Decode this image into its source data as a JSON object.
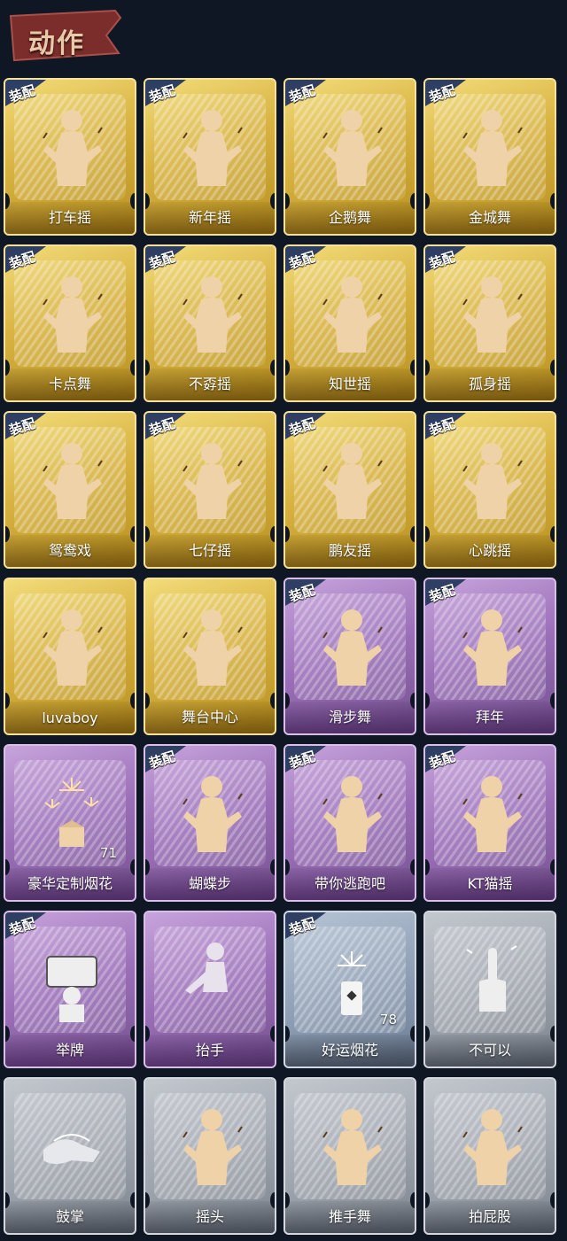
{
  "header": {
    "title": "动作"
  },
  "equip_badge": "装配",
  "colors": {
    "gold": "#d8b342",
    "purple": "#9b6fb8",
    "blue": "#8d9db3",
    "gray": "#9ea4ad",
    "background": "#0f1624"
  },
  "cards": [
    {
      "label": "打车摇",
      "tier": "gold",
      "equipped": true,
      "icon": "dance-figure-icon"
    },
    {
      "label": "新年摇",
      "tier": "gold",
      "equipped": true,
      "icon": "dance-figure-icon"
    },
    {
      "label": "企鹅舞",
      "tier": "gold",
      "equipped": true,
      "icon": "dance-figure-icon"
    },
    {
      "label": "金城舞",
      "tier": "gold",
      "equipped": true,
      "icon": "dance-figure-icon"
    },
    {
      "label": "卡点舞",
      "tier": "gold",
      "equipped": true,
      "icon": "dance-figure-icon"
    },
    {
      "label": "不孬摇",
      "tier": "gold",
      "equipped": true,
      "icon": "dance-figure-icon"
    },
    {
      "label": "知世摇",
      "tier": "gold",
      "equipped": true,
      "icon": "dance-figure-icon"
    },
    {
      "label": "孤身摇",
      "tier": "gold",
      "equipped": true,
      "icon": "dance-figure-icon"
    },
    {
      "label": "鸳鸯戏",
      "tier": "gold",
      "equipped": true,
      "icon": "dance-figure-icon"
    },
    {
      "label": "七仔摇",
      "tier": "gold",
      "equipped": true,
      "icon": "dance-figure-icon"
    },
    {
      "label": "鹏友摇",
      "tier": "gold",
      "equipped": true,
      "icon": "dance-figure-icon"
    },
    {
      "label": "心跳摇",
      "tier": "gold",
      "equipped": true,
      "icon": "dance-figure-icon"
    },
    {
      "label": "luvaboy",
      "tier": "gold",
      "equipped": false,
      "icon": "dance-figure-icon"
    },
    {
      "label": "舞台中心",
      "tier": "gold",
      "equipped": false,
      "icon": "dance-figure-icon"
    },
    {
      "label": "滑步舞",
      "tier": "purple",
      "equipped": true,
      "icon": "dance-figure-icon"
    },
    {
      "label": "拜年",
      "tier": "purple",
      "equipped": true,
      "icon": "dance-figure-icon"
    },
    {
      "label": "豪华定制烟花",
      "tier": "purple",
      "equipped": false,
      "icon": "firework-box-icon",
      "count": "71"
    },
    {
      "label": "蝴蝶步",
      "tier": "purple",
      "equipped": true,
      "icon": "dance-figure-icon"
    },
    {
      "label": "带你逃跑吧",
      "tier": "purple",
      "equipped": true,
      "icon": "dance-figure-icon"
    },
    {
      "label": "KT猫摇",
      "tier": "purple",
      "equipped": true,
      "icon": "dance-figure-icon"
    },
    {
      "label": "举牌",
      "tier": "purple",
      "equipped": true,
      "icon": "sign-holding-icon"
    },
    {
      "label": "抬手",
      "tier": "purple",
      "equipped": false,
      "icon": "raise-hand-icon"
    },
    {
      "label": "好运烟花",
      "tier": "blue",
      "equipped": true,
      "icon": "firework-can-icon",
      "count": "78"
    },
    {
      "label": "不可以",
      "tier": "gray",
      "equipped": false,
      "icon": "finger-wag-icon"
    },
    {
      "label": "鼓掌",
      "tier": "gray",
      "equipped": false,
      "icon": "clapping-icon"
    },
    {
      "label": "摇头",
      "tier": "gray",
      "equipped": false,
      "icon": "dance-figure-icon"
    },
    {
      "label": "推手舞",
      "tier": "gray",
      "equipped": false,
      "icon": "dance-figure-icon"
    },
    {
      "label": "拍屁股",
      "tier": "gray",
      "equipped": false,
      "icon": "dance-figure-icon"
    }
  ]
}
